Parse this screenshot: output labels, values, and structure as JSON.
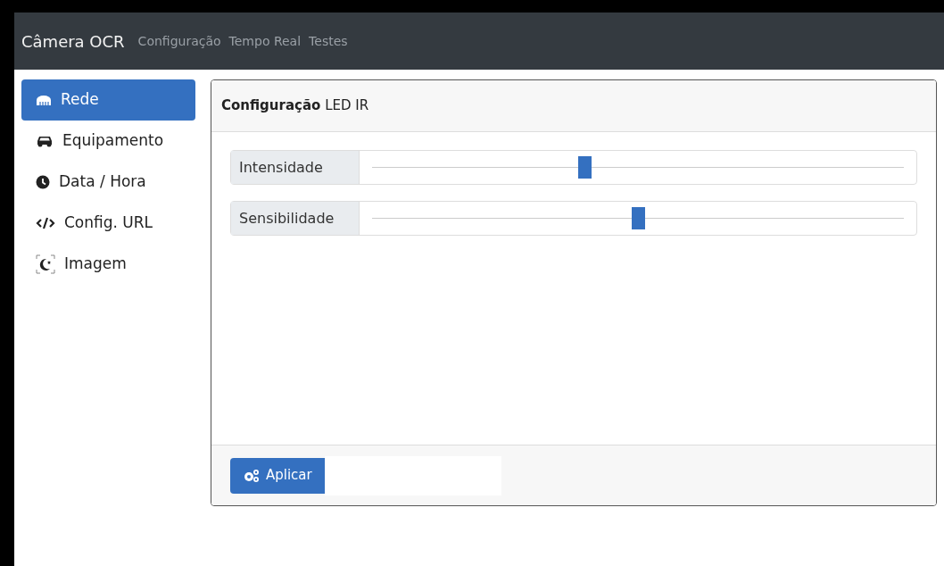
{
  "navbar": {
    "brand": "Câmera OCR",
    "links": [
      {
        "label": "Configuração",
        "selected": false
      },
      {
        "label": "Tempo Real",
        "selected": false
      },
      {
        "label": "Testes",
        "selected": false
      }
    ]
  },
  "sidebar": {
    "items": [
      {
        "label": "Rede",
        "selected": true
      },
      {
        "label": "Equipamento",
        "selected": false
      },
      {
        "label": "Data / Hora",
        "selected": false
      },
      {
        "label": "Config. URL",
        "selected": false
      },
      {
        "label": "Imagem",
        "selected": false
      }
    ]
  },
  "card": {
    "title": "**Configuração** LED IR",
    "sliders": [
      {
        "label": "Intensidade",
        "level": 0.4
      },
      {
        "label": "Sensibilidade",
        "level": 0.5
      }
    ],
    "button": "Aplicar"
  }
}
